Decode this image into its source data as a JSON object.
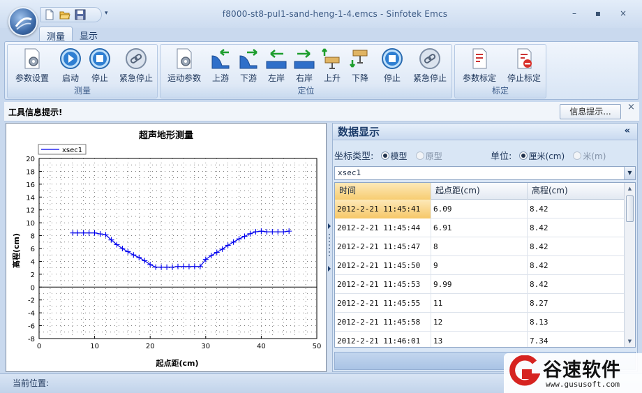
{
  "window": {
    "title": "f8000-st8-pul1-sand-heng-1-4.emcs - Sinfotek Emcs",
    "controls": [
      "–",
      "▪",
      "×"
    ]
  },
  "qat": {
    "icons": [
      "new-file-icon",
      "open-folder-icon",
      "save-icon"
    ],
    "dropdown": "▾"
  },
  "tabs": [
    {
      "label": "测量",
      "active": true
    },
    {
      "label": "显示",
      "active": false
    }
  ],
  "ribbon": {
    "groups": [
      {
        "label": "测量",
        "buttons": [
          "参数设置",
          "启动",
          "停止",
          "紧急停止"
        ]
      },
      {
        "label": "定位",
        "buttons": [
          "运动参数",
          "上游",
          "下游",
          "左岸",
          "右岸",
          "上升",
          "下降",
          "停止",
          "紧急停止"
        ]
      },
      {
        "label": "标定",
        "buttons": [
          "参数标定",
          "停止标定"
        ]
      }
    ]
  },
  "infobar": {
    "text": "工具信息提示!",
    "button": "信息提示...",
    "close": "×"
  },
  "chart_data": {
    "type": "line",
    "title": "超声地形测量",
    "xlabel": "起点距(cm)",
    "ylabel": "高程(cm)",
    "xlim": [
      0,
      50
    ],
    "ylim": [
      -8,
      20
    ],
    "xticks": [
      0,
      10,
      20,
      30,
      40,
      50
    ],
    "yticks": [
      20,
      18,
      16,
      14,
      12,
      10,
      8,
      6,
      4,
      2,
      0,
      -2,
      -4,
      -6,
      -8
    ],
    "grid": true,
    "legend": "top-left",
    "series": [
      {
        "name": "xsec1",
        "color": "#0000ee",
        "x": [
          6.09,
          6.91,
          8,
          9,
          9.99,
          11,
          12,
          13,
          14,
          15,
          16,
          17,
          18,
          19,
          20,
          21,
          22,
          23,
          24,
          25,
          26,
          27,
          28,
          29,
          30,
          31,
          32,
          33,
          34,
          35,
          36,
          37,
          38,
          39,
          40,
          41,
          42,
          43,
          44,
          45
        ],
        "y": [
          8.42,
          8.42,
          8.42,
          8.42,
          8.42,
          8.27,
          8.13,
          7.34,
          6.6,
          6.0,
          5.5,
          5.0,
          4.6,
          4.1,
          3.5,
          3.1,
          3.1,
          3.1,
          3.1,
          3.2,
          3.2,
          3.2,
          3.2,
          3.2,
          4.3,
          4.9,
          5.4,
          5.9,
          6.5,
          7.0,
          7.5,
          7.9,
          8.3,
          8.6,
          8.7,
          8.6,
          8.6,
          8.6,
          8.6,
          8.7
        ]
      }
    ]
  },
  "data_panel": {
    "title": "数据显示",
    "collapse": "«",
    "coord_label": "坐标类型:",
    "coord_options": [
      {
        "label": "模型",
        "checked": true
      },
      {
        "label": "原型",
        "checked": false
      }
    ],
    "unit_label": "单位:",
    "unit_options": [
      {
        "label": "厘米(cm)",
        "checked": true
      },
      {
        "label": "米(m)",
        "checked": false
      }
    ],
    "series_select": "xsec1",
    "columns": [
      "时间",
      "起点距(cm)",
      "高程(cm)"
    ],
    "rows": [
      [
        "2012-2-21 11:45:41",
        "6.09",
        "8.42"
      ],
      [
        "2012-2-21 11:45:44",
        "6.91",
        "8.42"
      ],
      [
        "2012-2-21 11:45:47",
        "8",
        "8.42"
      ],
      [
        "2012-2-21 11:45:50",
        "9",
        "8.42"
      ],
      [
        "2012-2-21 11:45:53",
        "9.99",
        "8.42"
      ],
      [
        "2012-2-21 11:45:55",
        "11",
        "8.27"
      ],
      [
        "2012-2-21 11:45:58",
        "12",
        "8.13"
      ],
      [
        "2012-2-21 11:46:01",
        "13",
        "7.34"
      ]
    ]
  },
  "status": {
    "text": "当前位置:"
  },
  "watermark": {
    "brand": "谷速软件",
    "url": "www.gususoft.com"
  }
}
